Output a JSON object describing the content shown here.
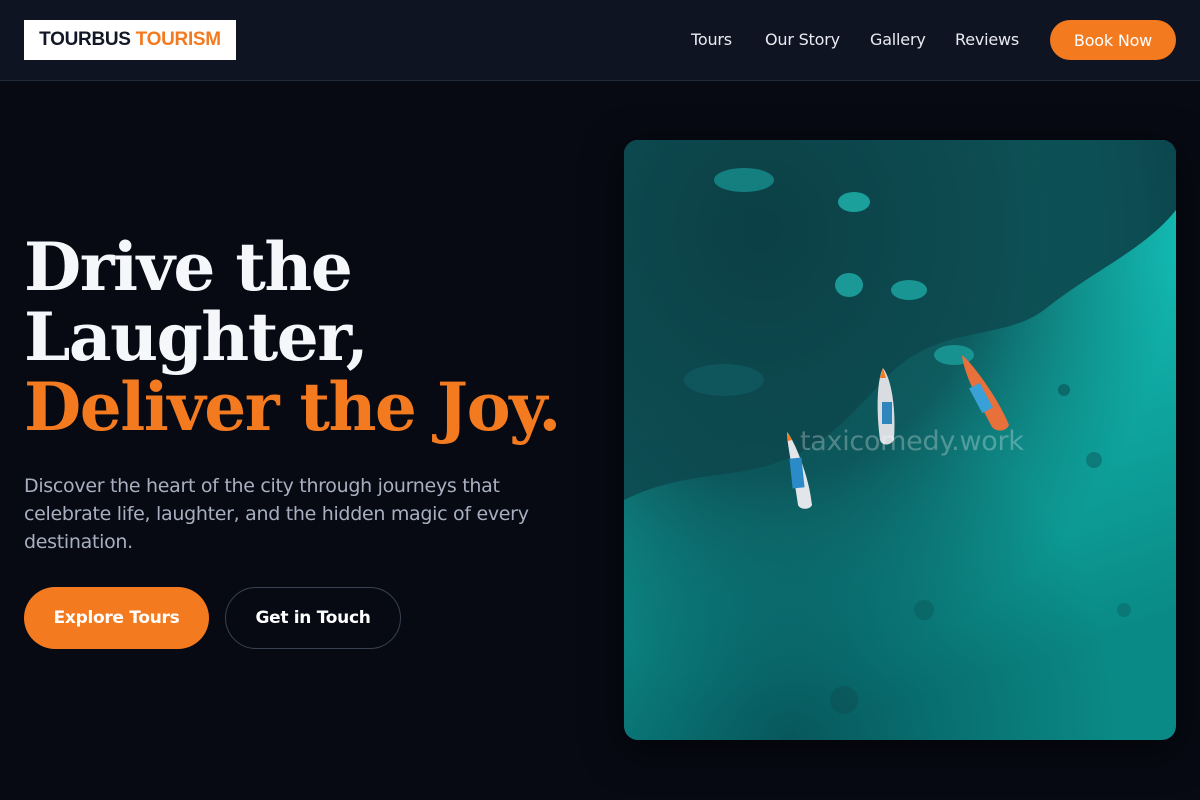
{
  "brand": {
    "name_part1": "TOURBUS",
    "name_part2": "TOURISM"
  },
  "nav": {
    "links": [
      "Tours",
      "Our Story",
      "Gallery",
      "Reviews"
    ],
    "cta": "Book Now"
  },
  "hero": {
    "title_line1": "Drive the",
    "title_line2": "Laughter,",
    "title_line3": "Deliver the Joy.",
    "description": "Discover the heart of the city through journeys that celebrate life, laughter, and the hidden magic of every destination.",
    "primary_button": "Explore Tours",
    "secondary_button": "Get in Touch",
    "image_watermark": "taxicomedy.work",
    "image_subject": "aerial view of turquoise sea with longtail boats"
  },
  "colors": {
    "accent": "#f47a20",
    "background": "#070a13",
    "navbar": "#0f1422"
  }
}
